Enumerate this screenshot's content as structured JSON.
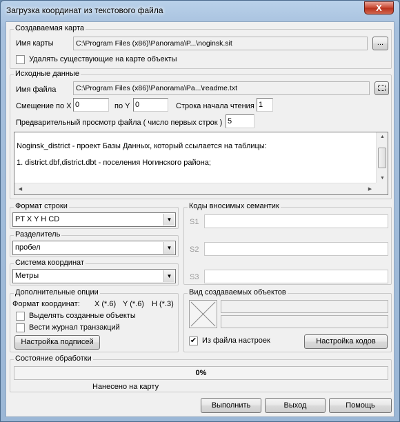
{
  "window": {
    "title": "Загрузка координат из текстового файла",
    "close_label": "X"
  },
  "map_group": {
    "title": "Создаваемая карта",
    "name_label": "Имя карты",
    "name_value": "C:\\Program Files (x86)\\Panorama\\P...\\noginsk.sit",
    "browse_label": "...",
    "delete_checkbox_label": "Удалять существующие на карте объекты",
    "delete_checked": false
  },
  "source_group": {
    "title": "Исходные данные",
    "file_label": "Имя файла",
    "file_value": "C:\\Program Files (x86)\\Panorama\\Pa...\\readme.txt",
    "offset_x_label": "Смещение по X",
    "offset_x_value": "0",
    "offset_y_label": "по Y",
    "offset_y_value": "0",
    "start_row_label": "Строка начала чтения",
    "start_row_value": "1",
    "preview_label": "Предварительный просмотр файла ( число первых строк )",
    "preview_value": "5",
    "preview_lines": [
      "Noginsk_district - проект Базы Данных, который ссылается на  таблицы:",
      "1. district.dbf,district.dbt - поселения Ногинского района;"
    ]
  },
  "row_format": {
    "title": "Формат строки",
    "value": "PT  X  Y  H CD"
  },
  "separator": {
    "title": "Разделитель",
    "value": "пробел"
  },
  "coord_system": {
    "title": "Система координат",
    "value": "Метры"
  },
  "extra_options": {
    "title": "Дополнительные опции",
    "format_label": "Формат координат:",
    "format_x": "X (*.6)",
    "format_y": "Y (*.6)",
    "format_h": "H (*.3)",
    "select_label": "Выделять созданные объекты",
    "select_checked": false,
    "journal_label": "Вести журнал транзакций",
    "journal_checked": false,
    "labels_button": "Настройка подписей"
  },
  "semantics": {
    "title": "Коды вносимых семантик",
    "s1_label": "S1",
    "s1_value": "",
    "s2_label": "S2",
    "s2_value": "",
    "s3_label": "S3",
    "s3_value": ""
  },
  "object_view": {
    "title": "Вид создаваемых объектов",
    "from_settings_label": "Из файла настроек",
    "from_settings_checked": true,
    "codes_button": "Настройка кодов"
  },
  "status": {
    "title": "Состояние обработки",
    "progress_text": "0%",
    "progress_value": 0,
    "status_text": "Нанесено на карту"
  },
  "buttons": {
    "run": "Выполнить",
    "exit": "Выход",
    "help": "Помощь"
  },
  "checkmark": "✔",
  "arrows": {
    "down": "▼",
    "up": "▲",
    "left": "◀",
    "right": "▶"
  }
}
